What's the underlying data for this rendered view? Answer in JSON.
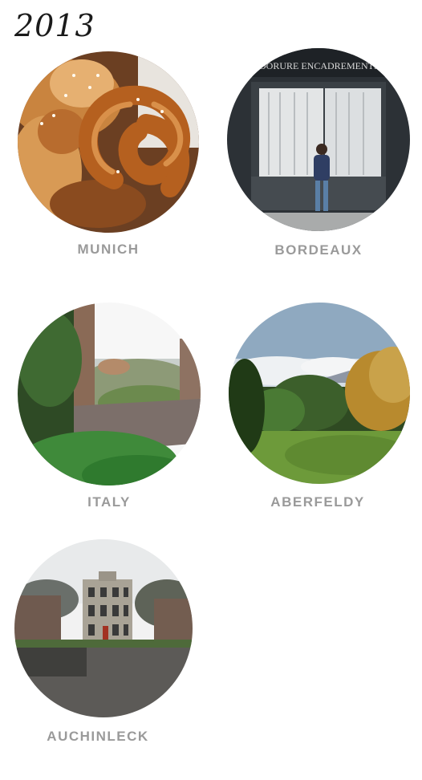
{
  "title": "2013",
  "places": [
    {
      "name": "MUNICH"
    },
    {
      "name": "BORDEAUX",
      "sign": "DORURE ENCADREMENTS"
    },
    {
      "name": "ITALY"
    },
    {
      "name": "ABERFELDY"
    },
    {
      "name": "AUCHINLECK"
    }
  ]
}
